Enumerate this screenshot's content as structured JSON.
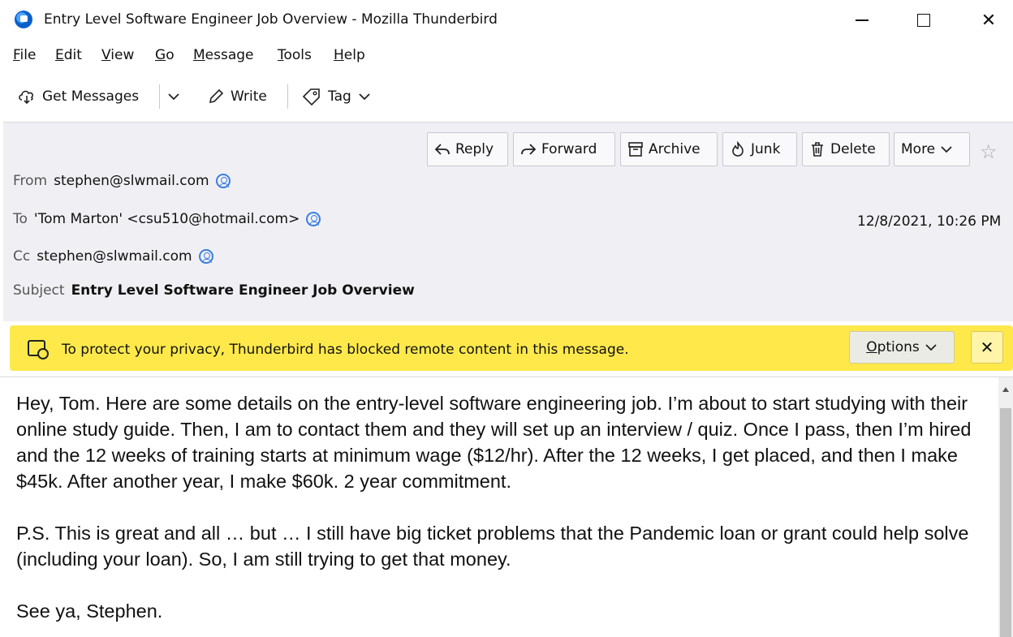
{
  "window": {
    "title": "Entry Level Software Engineer Job Overview - Mozilla Thunderbird",
    "app_icon": "thunderbird-icon"
  },
  "menu": [
    {
      "accel": "F",
      "rest": "ile"
    },
    {
      "accel": "E",
      "rest": "dit"
    },
    {
      "accel": "V",
      "rest": "iew"
    },
    {
      "accel": "G",
      "rest": "o"
    },
    {
      "accel": "M",
      "rest": "essage"
    },
    {
      "accel": "T",
      "rest": "ools"
    },
    {
      "accel": "H",
      "rest": "elp"
    }
  ],
  "toolbar": {
    "get_messages": "Get Messages",
    "write": "Write",
    "tag": "Tag"
  },
  "actions": {
    "reply": "Reply",
    "forward": "Forward",
    "archive": "Archive",
    "junk": "Junk",
    "delete": "Delete",
    "more": "More"
  },
  "headers": {
    "from_label": "From",
    "from_value": "stephen@slwmail.com",
    "to_label": "To",
    "to_value": "'Tom Marton' <csu510@hotmail.com>",
    "cc_label": "Cc",
    "cc_value": "stephen@slwmail.com",
    "subject_label": "Subject",
    "subject_value": "Entry Level Software Engineer Job Overview",
    "date": "12/8/2021, 10:26 PM"
  },
  "notice": {
    "text": "To protect your privacy, Thunderbird has blocked remote content in this message.",
    "options_accel": "O",
    "options_rest": "ptions",
    "close": "✕",
    "color": "#ffe94a"
  },
  "body": {
    "paragraphs": [
      "Hey, Tom. Here are some details on the entry-level software engineering job. I’m about to start studying with their online study guide. Then, I am to contact them and they will set up an interview / quiz. Once I pass, then I’m hired and the 12 weeks of training starts at minimum wage ($12/hr). After the 12 weeks, I get placed, and then I make $45k. After another year, I make $60k. 2 year commitment.",
      "P.S. This is great and all … but … I still have big ticket problems that the Pandemic loan or grant could help solve (including your loan). So, I am still trying to get that money.",
      "See ya, Stephen."
    ]
  }
}
